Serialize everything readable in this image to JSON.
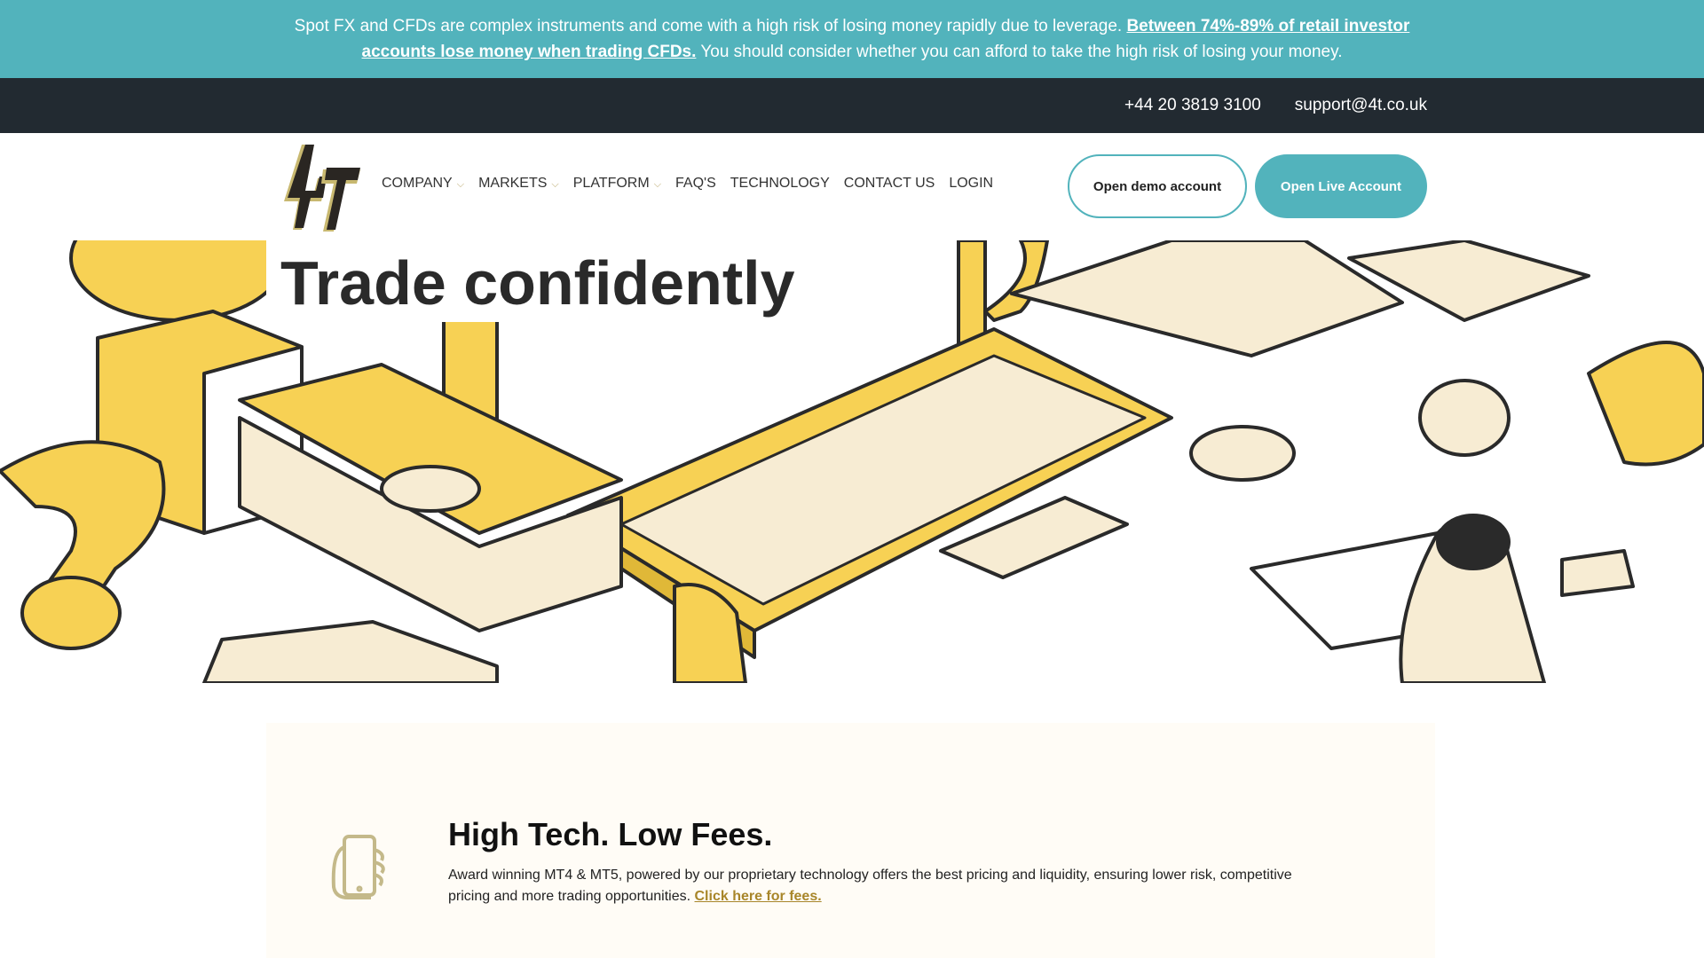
{
  "risk_warning": {
    "text_before": "Spot FX and CFDs are complex instruments and come with a high risk of losing money rapidly due to leverage. ",
    "link": "Between 74%-89% of retail investor accounts lose money when trading CFDs.",
    "text_after": " You should consider whether you can afford to take the high risk of losing your money."
  },
  "topbar": {
    "phone": "+44 20 3819 3100",
    "email": "support@4t.co.uk"
  },
  "logo": "4T",
  "nav": {
    "items": [
      {
        "label": "COMPANY",
        "dropdown": true
      },
      {
        "label": "MARKETS",
        "dropdown": true
      },
      {
        "label": "PLATFORM",
        "dropdown": true
      },
      {
        "label": "FAQ'S"
      },
      {
        "label": "TECHNOLOGY"
      },
      {
        "label": "CONTACT US"
      },
      {
        "label": "LOGIN"
      }
    ],
    "chevron": "⌵",
    "demo_button": "Open demo account",
    "live_button": "Open Live Account"
  },
  "hero": {
    "title": "Trade confidently"
  },
  "feature": {
    "icon": "phone-in-hand-icon",
    "title": "High Tech. Low Fees.",
    "text": "Award winning MT4 & MT5, powered by our proprietary technology offers the best pricing and liquidity, ensuring lower risk, competitive pricing and more trading opportunities. ",
    "link": "Click here for fees."
  },
  "colors": {
    "accent": "#52b3bc",
    "dark": "#222a31",
    "yellow": "#f7d154",
    "cream": "#f7ecd3",
    "gold": "#a8862a"
  }
}
